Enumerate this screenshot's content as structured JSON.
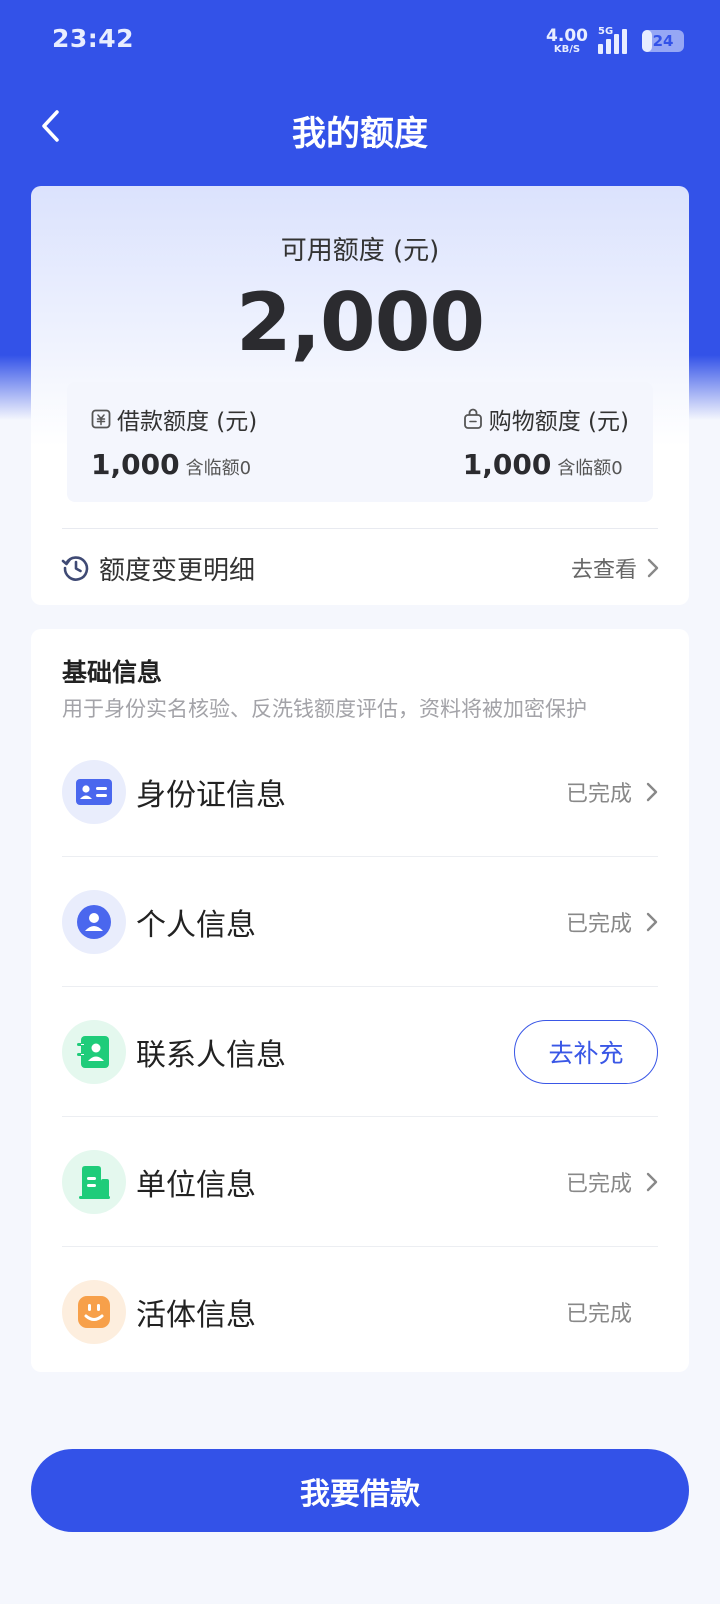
{
  "status": {
    "time": "23:42",
    "net_speed": "4.00",
    "net_unit": "KB/S",
    "network": "5G",
    "battery": "24"
  },
  "header": {
    "title": "我的额度",
    "back_icon": "chevron-left-icon"
  },
  "quota": {
    "available_label": "可用额度 (元)",
    "available_amount": "2,000",
    "loan": {
      "label": "借款额度 (元)",
      "amount": "1,000",
      "note": "含临额0",
      "icon": "money-bill-icon"
    },
    "shopping": {
      "label": "购物额度 (元)",
      "amount": "1,000",
      "note": "含临额0",
      "icon": "shopping-bag-icon"
    },
    "change": {
      "label": "额度变更明细",
      "action": "去查看",
      "icon": "history-icon"
    }
  },
  "basic_info": {
    "title": "基础信息",
    "subtitle": "用于身份实名核验、反洗钱额度评估，资料将被加密保护",
    "items": [
      {
        "label": "身份证信息",
        "status": "已完成",
        "icon": "id-card-icon",
        "color": "#4a67ee"
      },
      {
        "label": "个人信息",
        "status": "已完成",
        "icon": "person-icon",
        "color": "#4a67ee"
      },
      {
        "label": "联系人信息",
        "action": "去补充",
        "icon": "contact-book-icon",
        "color": "#1fcc7a"
      },
      {
        "label": "单位信息",
        "status": "已完成",
        "icon": "building-icon",
        "color": "#1fcc7a"
      },
      {
        "label": "活体信息",
        "status": "已完成",
        "icon": "face-icon",
        "color": "#f7a04a"
      }
    ]
  },
  "actions": {
    "borrow": "我要借款"
  },
  "colors": {
    "primary": "#3352e8",
    "background": "#f5f7fd",
    "muted_text": "#888888"
  }
}
